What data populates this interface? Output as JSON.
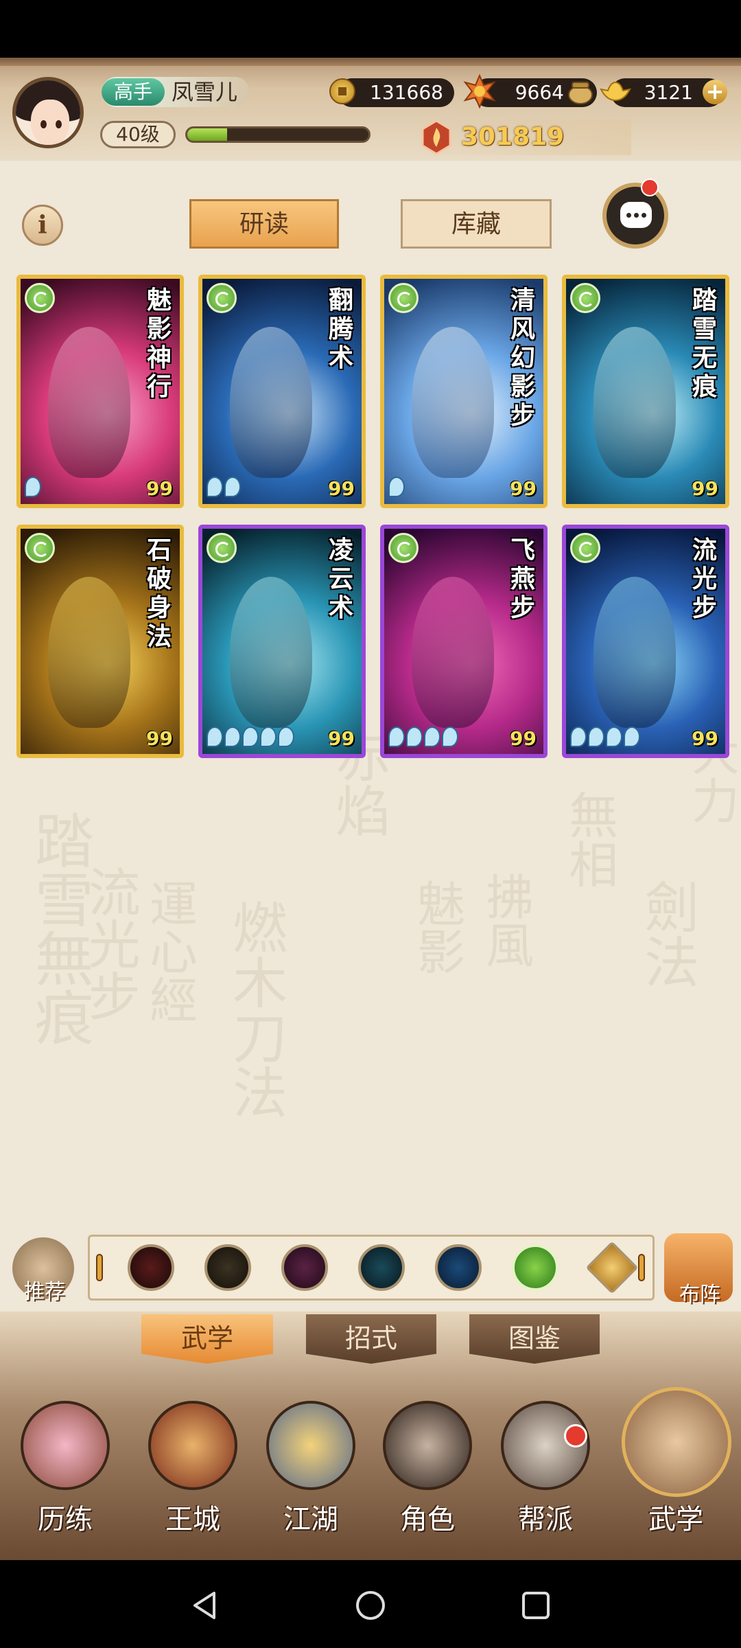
{
  "header": {
    "rank": "高手",
    "player_name": "凤雪儿",
    "level": "40级",
    "exp_fraction": 0.22,
    "coins": "131668",
    "lingzhi": "9664",
    "gold": "3121",
    "power": "301819",
    "icons": [
      "avatar",
      "coin-icon",
      "flame-flower-icon",
      "pot-icon",
      "gold-ingot-icon",
      "plus-icon",
      "power-flame-icon"
    ]
  },
  "toolbar": {
    "info_label": "i",
    "tab_study": "研读",
    "tab_storage": "库藏"
  },
  "cards": [
    {
      "name": "魅影神行",
      "level": "99",
      "stars": 1,
      "frame": "gold",
      "art": [
        "#3a0a22",
        "#d83a7a",
        "#f7a2c6"
      ]
    },
    {
      "name": "翻腾术",
      "level": "99",
      "stars": 2,
      "frame": "gold",
      "art": [
        "#0a1a3a",
        "#2a6ab6",
        "#c6e2f7"
      ]
    },
    {
      "name": "清风幻影步",
      "level": "99",
      "stars": 1,
      "frame": "gold",
      "art": [
        "#1a3a6a",
        "#6aa6e6",
        "#e2f0fb"
      ]
    },
    {
      "name": "踏雪无痕",
      "level": "99",
      "stars": 0,
      "frame": "gold",
      "art": [
        "#06243a",
        "#2a8ab6",
        "#bfeff7"
      ]
    },
    {
      "name": "石破身法",
      "level": "99",
      "stars": 0,
      "frame": "gold",
      "art": [
        "#2a1a06",
        "#a6741a",
        "#f7d25a"
      ]
    },
    {
      "name": "凌云术",
      "level": "99",
      "stars": 5,
      "frame": "purple",
      "art": [
        "#06202a",
        "#2a96b6",
        "#a6e6f0"
      ]
    },
    {
      "name": "飞燕步",
      "level": "99",
      "stars": 4,
      "frame": "purple",
      "art": [
        "#2a0630",
        "#b62a8a",
        "#f26ab6"
      ]
    },
    {
      "name": "流光步",
      "level": "99",
      "stars": 4,
      "frame": "purple",
      "art": [
        "#06163a",
        "#2a62b6",
        "#8ad6f7"
      ]
    }
  ],
  "filter": {
    "recommend_label": "推荐",
    "formation_label": "布阵",
    "icons": [
      "sword-filter-icon",
      "blade-filter-icon",
      "fist-filter-icon",
      "palm-filter-icon",
      "taiji-filter-icon",
      "movement-filter-icon",
      "special-filter-icon"
    ]
  },
  "subtabs": [
    "武学",
    "招式",
    "图鉴"
  ],
  "nav": [
    "历练",
    "王城",
    "江湖",
    "角色",
    "帮派",
    "武学"
  ],
  "background_text": [
    "踏雪無痕",
    "流光步",
    "運心經",
    "燃木刀法",
    "赤焰",
    "魅影",
    "拂風",
    "無相",
    "劍法",
    "大力"
  ]
}
